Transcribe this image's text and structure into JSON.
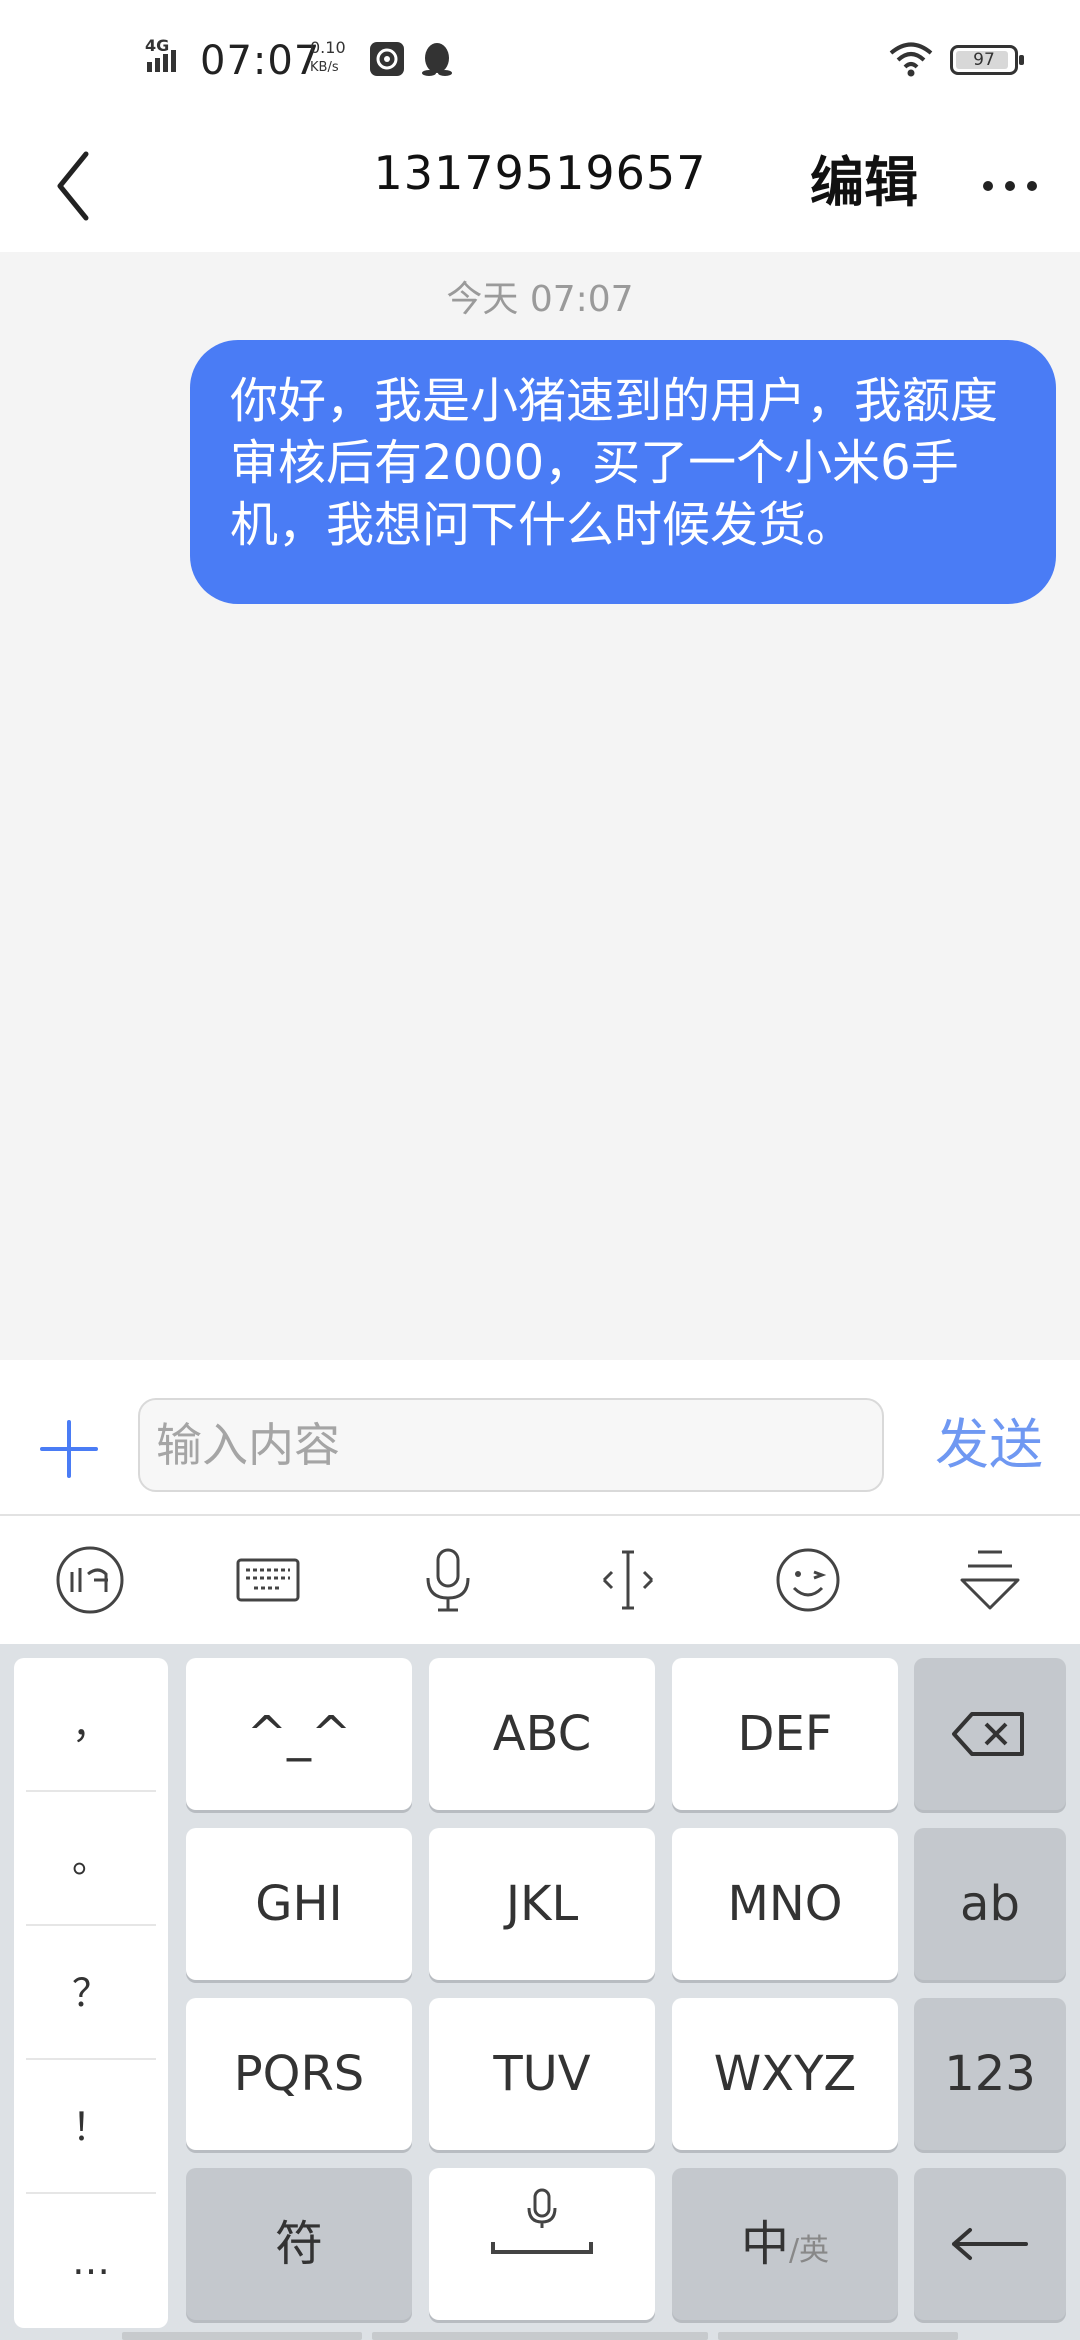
{
  "status_bar": {
    "network": "4G",
    "time": "07:07",
    "speed_value": "0.10",
    "speed_unit": "KB/s",
    "battery": "97",
    "icons": [
      "signal-icon",
      "app-notification-icon",
      "qq-icon",
      "wifi-icon",
      "battery-icon"
    ]
  },
  "header": {
    "back_icon": "chevron-left-icon",
    "title": "13179519657",
    "edit_label": "编辑",
    "more_icon": "more-horizontal-icon"
  },
  "conversation": {
    "timestamp": "今天 07:07",
    "messages": [
      {
        "direction": "outgoing",
        "text": "你好，我是小猪速到的用户，我额度审核后有2000，买了一个小米6手机，我想问下什么时候发货。"
      }
    ]
  },
  "composer": {
    "plus_icon": "plus-icon",
    "input_placeholder": "输入内容",
    "input_value": "",
    "send_label": "发送"
  },
  "ime_toolbar": {
    "icons": [
      "ifly-logo-icon",
      "keyboard-icon",
      "microphone-icon",
      "cursor-move-icon",
      "emoji-icon",
      "hide-keyboard-icon"
    ]
  },
  "keyboard": {
    "punctuation": [
      "，",
      "。",
      "？",
      "！",
      "…"
    ],
    "rows": [
      [
        "^_^",
        "ABC",
        "DEF"
      ],
      [
        "GHI",
        "JKL",
        "MNO"
      ],
      [
        "PQRS",
        "TUV",
        "WXYZ"
      ]
    ],
    "right_keys": [
      "backspace",
      "ab",
      "123",
      "enter"
    ],
    "bottom": {
      "symbol_label": "符",
      "lang_main": "中",
      "lang_sub": "/英"
    }
  },
  "colors": {
    "accent": "#4a7cf5",
    "send": "#6f98f2",
    "keyboard_bg": "#dde1e5"
  }
}
